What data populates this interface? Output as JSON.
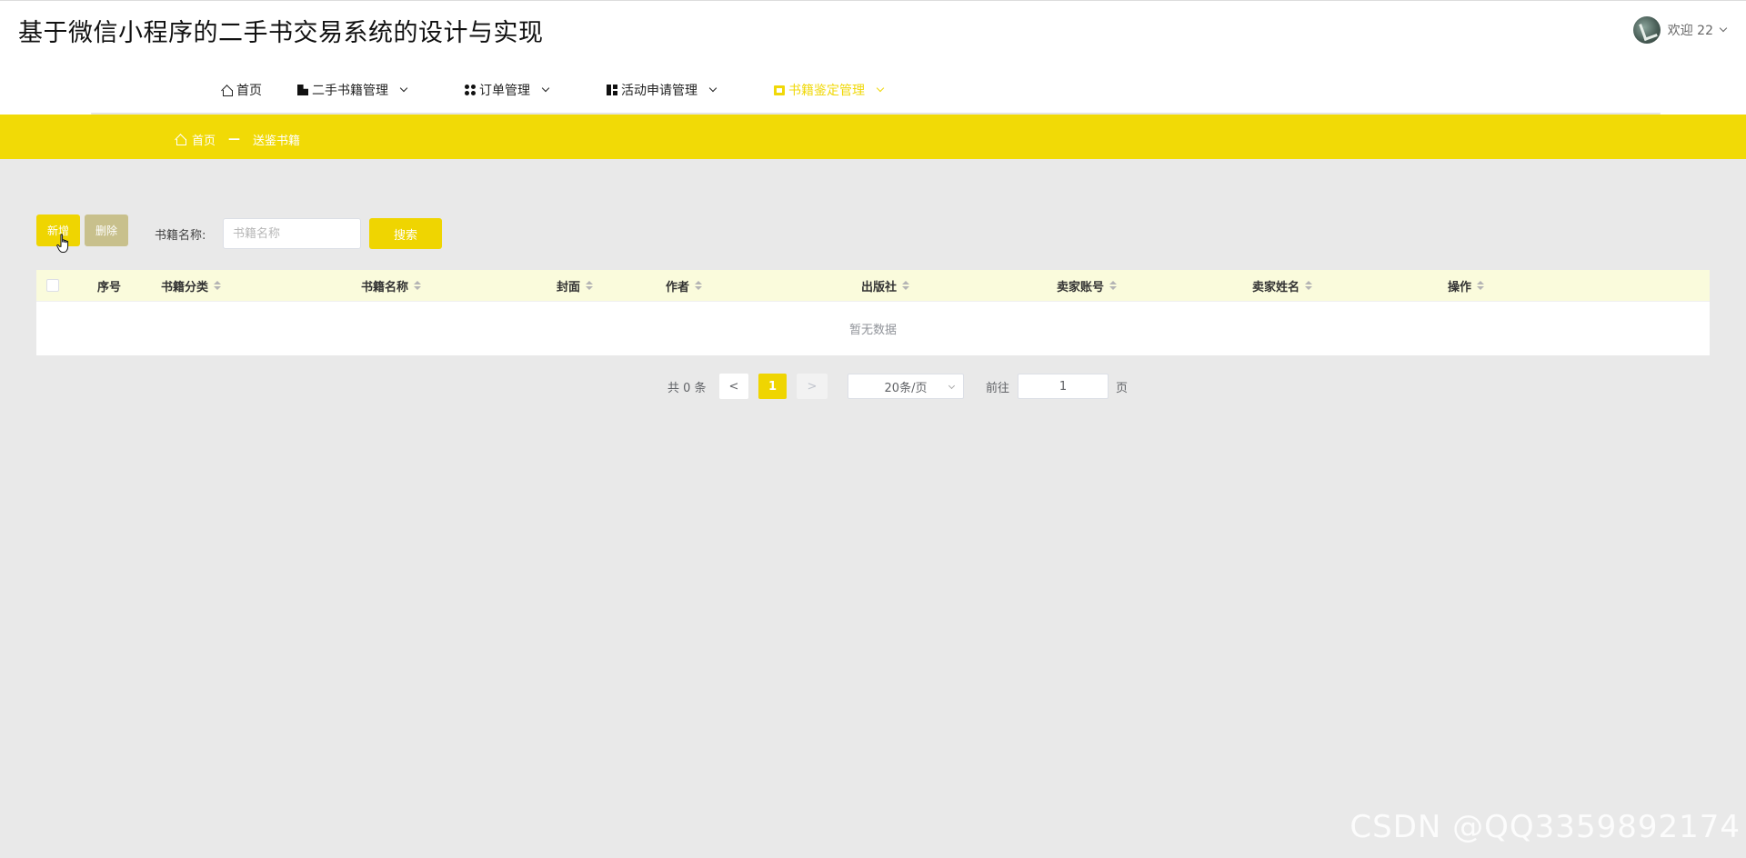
{
  "header": {
    "title": "基于微信小程序的二手书交易系统的设计与实现",
    "welcome": "欢迎 22"
  },
  "nav": [
    {
      "label": "首页",
      "icon": "home-icon"
    },
    {
      "label": "二手书籍管理",
      "icon": "book-icon"
    },
    {
      "label": "订单管理",
      "icon": "grid-icon"
    },
    {
      "label": "活动申请管理",
      "icon": "layout-icon"
    },
    {
      "label": "书籍鉴定管理",
      "icon": "badge-icon",
      "active": true
    }
  ],
  "breadcrumb": {
    "home": "首页",
    "separator": "—",
    "current": "送鉴书籍"
  },
  "toolbar": {
    "add_label": "新增",
    "delete_label": "删除",
    "name_label": "书籍名称:",
    "name_placeholder": "书籍名称",
    "search_label": "搜索"
  },
  "table": {
    "columns": [
      "序号",
      "书籍分类",
      "书籍名称",
      "封面",
      "作者",
      "出版社",
      "卖家账号",
      "卖家姓名",
      "操作"
    ],
    "rows": [],
    "empty_text": "暂无数据"
  },
  "pagination": {
    "total_text": "共 0 条",
    "prev": "<",
    "current_page": "1",
    "next": ">",
    "page_size": "20条/页",
    "goto_label": "前往",
    "goto_value": "1",
    "page_suffix": "页"
  },
  "watermark": "CSDN @QQ3359892174",
  "colors": {
    "accent": "#efd501",
    "breadcrumb_band": "#f1da06",
    "delete_button": "#c8c08c",
    "table_header": "#fafbdc",
    "page_bg": "#e9e9e9"
  }
}
